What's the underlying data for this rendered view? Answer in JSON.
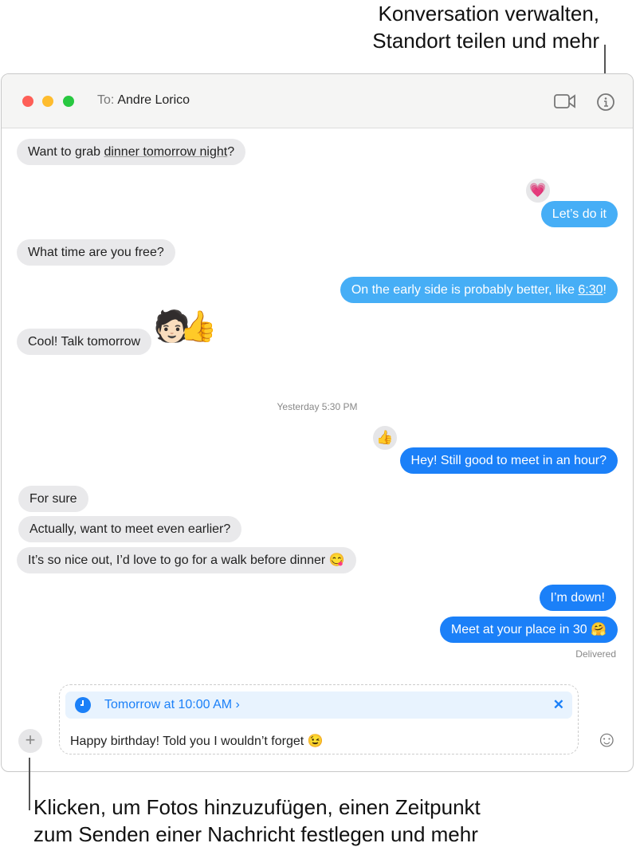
{
  "annotations": {
    "top": [
      "Konversation verwalten,",
      "Standort teilen und mehr"
    ],
    "bottom": [
      "Klicken, um Fotos hinzuzufügen, einen Zeitpunkt",
      "zum Senden einer Nachricht festlegen und mehr"
    ]
  },
  "header": {
    "to_label": "To:",
    "recipient": "Andre Lorico",
    "icons": [
      "video-camera-icon",
      "info-icon"
    ]
  },
  "messages": [
    {
      "from": "them",
      "pre": "Want to grab ",
      "link": "dinner tomorrow night",
      "post": "?"
    },
    {
      "from": "me",
      "text": "Let’s do it",
      "tapback": "💗"
    },
    {
      "from": "them",
      "text": "What time are you free?"
    },
    {
      "from": "me",
      "pre": "On the early side is probably better, like ",
      "link": "6:30",
      "post": "!"
    },
    {
      "from": "them",
      "text": "Cool! Talk tomorrow",
      "sticker": "🧑🏻👍"
    },
    {
      "from": "me",
      "text": "Hey! Still good to meet in an hour?",
      "tapback": "👍"
    },
    {
      "from": "them",
      "text": "For sure"
    },
    {
      "from": "them",
      "text": "Actually, want to meet even earlier?"
    },
    {
      "from": "them",
      "text": "It’s so nice out, I’d love to go for a walk before dinner 😋"
    },
    {
      "from": "me",
      "text": "I’m down!"
    },
    {
      "from": "me",
      "text": "Meet at your place in 30 🤗"
    }
  ],
  "timestamp": "Yesterday 5:30 PM",
  "status": "Delivered",
  "compose": {
    "schedule": "Tomorrow at 10:00 AM ›",
    "close": "✕",
    "text": "Happy birthday! Told you I wouldn’t forget 😉",
    "plus": "+",
    "emoji": "☺"
  },
  "colors": {
    "sent_old": "#46aef6",
    "sent_new": "#1b80f8",
    "received": "#e9e9eb",
    "accent": "#1b80f8"
  }
}
